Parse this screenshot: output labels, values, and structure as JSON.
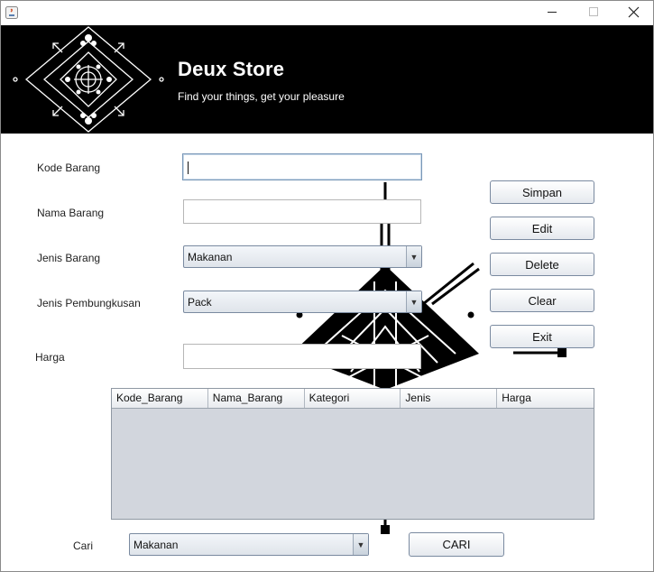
{
  "window": {
    "title": "",
    "controls": {
      "minimize": "minimize-icon",
      "maximize": "maximize-icon",
      "close": "close-icon"
    }
  },
  "banner": {
    "title": "Deux Store",
    "subtitle": "Find your things, get your pleasure"
  },
  "form": {
    "kode_label": "Kode Barang",
    "kode_value": "",
    "nama_label": "Nama Barang",
    "nama_value": "",
    "jenis_label": "Jenis Barang",
    "jenis_value": "Makanan",
    "pembungkusan_label": "Jenis Pembungkusan",
    "pembungkusan_value": "Pack",
    "harga_label": "Harga",
    "harga_value": ""
  },
  "buttons": {
    "simpan": "Simpan",
    "edit": "Edit",
    "delete": "Delete",
    "clear": "Clear",
    "exit": "Exit",
    "cari": "CARI"
  },
  "table": {
    "columns": [
      "Kode_Barang",
      "Nama_Barang",
      "Kategori",
      "Jenis",
      "Harga"
    ],
    "rows": []
  },
  "search": {
    "label": "Cari",
    "value": "Makanan"
  },
  "colors": {
    "banner_bg": "#000000",
    "table_bg": "#d2d6dd"
  }
}
